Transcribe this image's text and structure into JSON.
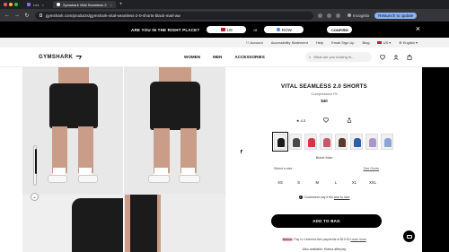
{
  "browser": {
    "tabs": [
      {
        "label": "Lex",
        "active": false
      },
      {
        "label": "Gymshark Vital Seamless 2.0 S",
        "active": true
      }
    ],
    "url": "gymshark.com/products/gymshark-vital-seamless-2-0-shorts-black-marl-aw",
    "incognito_label": "Incognito",
    "relaunch_label": "Relaunch to update"
  },
  "banner": {
    "question": "ARE YOU IN THE RIGHT PLACE?",
    "us_label": "US",
    "or_label": "or",
    "row_label": "ROW",
    "confirm_label": "CONFIRM"
  },
  "utility": {
    "account": "Account",
    "accessibility": "Accessibility Statement",
    "help": "Help",
    "email": "Email Sign Up",
    "blog": "Blog",
    "region": "US",
    "language": "English"
  },
  "header": {
    "logo": "GYMSHARK",
    "nav": [
      "WOMEN",
      "MEN",
      "ACCESSORIES"
    ],
    "search_placeholder": "What are you looking fo..."
  },
  "product": {
    "title": "VITAL SEAMLESS 2.0 SHORTS",
    "fit": "Compression Fit",
    "price": "$40",
    "rating": "4.3",
    "color_name": "Black Marl",
    "swatch_colors": [
      "#1a1a1a",
      "#4a4a4a",
      "#d8334a",
      "#c25a6a",
      "#5a3a2a",
      "#2e5fa8",
      "#a995c9",
      "#8aa5d6"
    ],
    "select_size_label": "Select a size",
    "size_guide_label": "Size Guide",
    "sizes": [
      "XS",
      "S",
      "M",
      "L",
      "XL",
      "XXL"
    ],
    "fit_note": "Customers say it fits",
    "fit_note_link": "true to size",
    "add_to_bag": "ADD TO BAG",
    "klarna_text": "Pay in 4 interest-free payments of $10.00",
    "klarna_brand": "Klarna.",
    "klarna_link": "Learn more",
    "availability": "Also available: Klarna afterpay"
  }
}
